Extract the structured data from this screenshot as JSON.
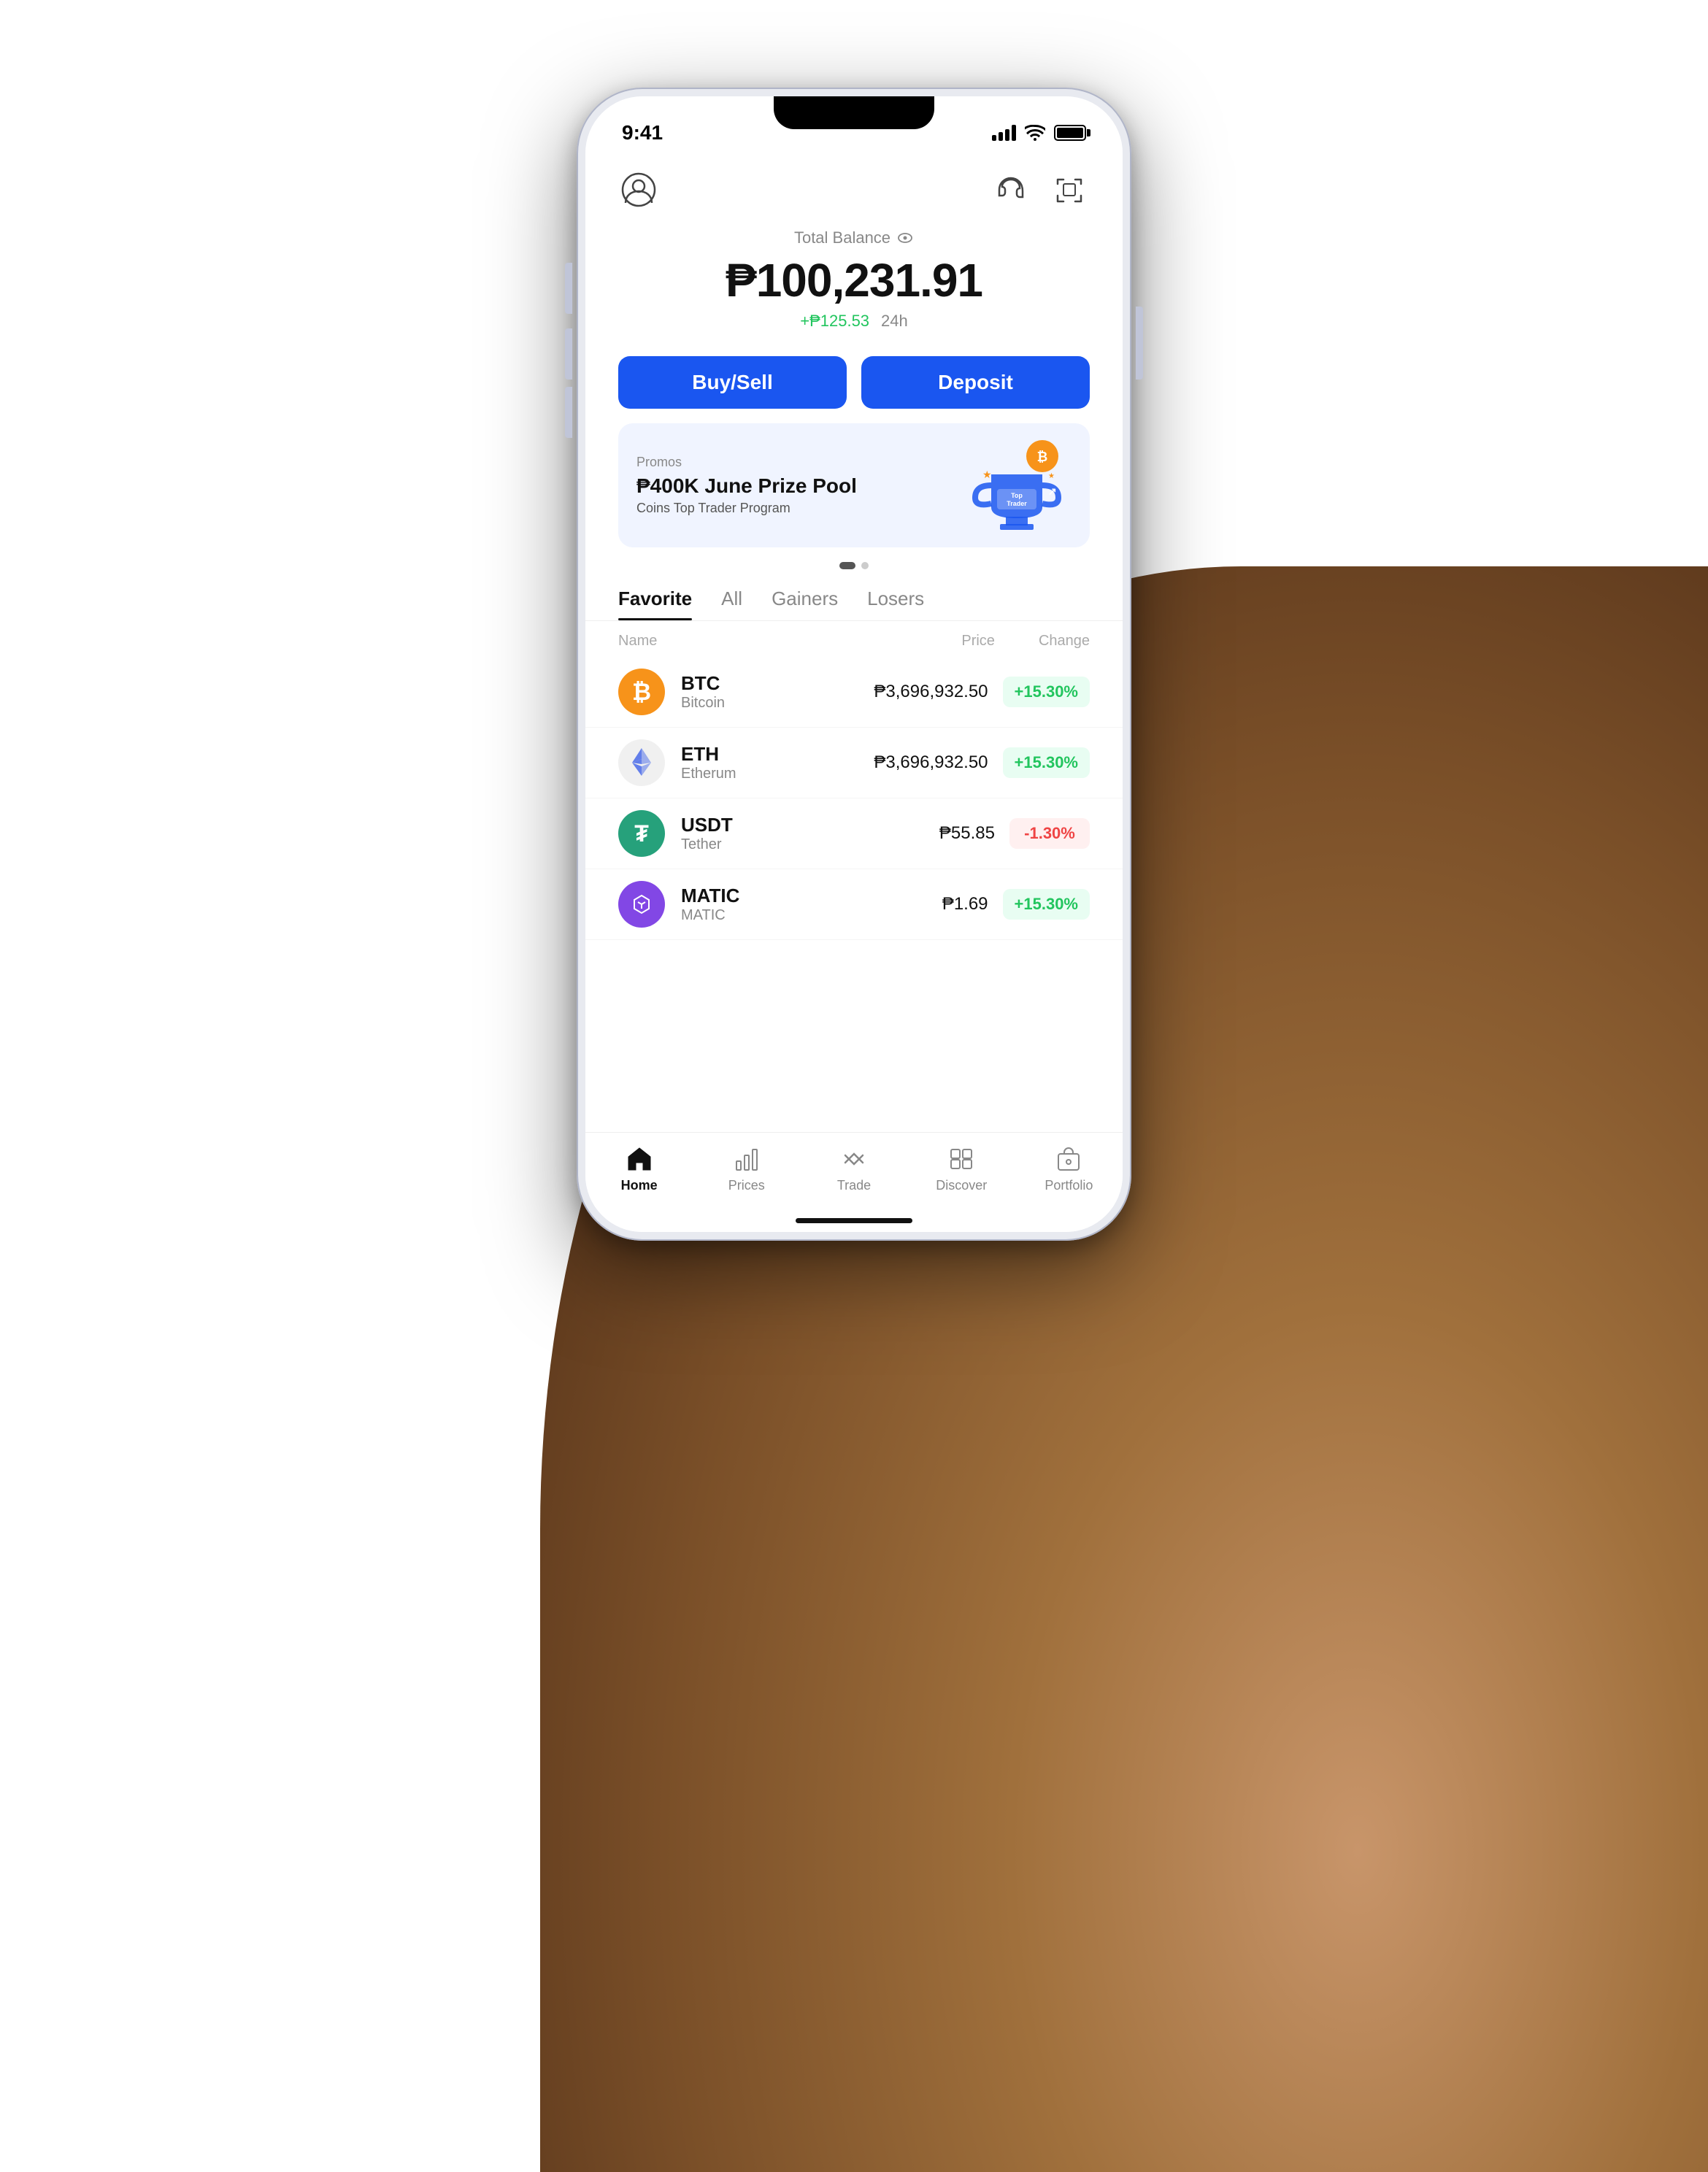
{
  "status_bar": {
    "time": "9:41"
  },
  "header": {
    "balance_label": "Total Balance",
    "balance_amount": "₱100,231.91",
    "balance_change": "+₱125.53",
    "balance_period": "24h"
  },
  "actions": {
    "buy_sell": "Buy/Sell",
    "deposit": "Deposit"
  },
  "promo": {
    "label": "Promos",
    "title": "₱400K June Prize Pool",
    "subtitle": "Coins Top Trader Program",
    "banner_text": "Top Trader"
  },
  "tabs": [
    {
      "id": "favorite",
      "label": "Favorite",
      "active": true
    },
    {
      "id": "all",
      "label": "All",
      "active": false
    },
    {
      "id": "gainers",
      "label": "Gainers",
      "active": false
    },
    {
      "id": "losers",
      "label": "Losers",
      "active": false
    }
  ],
  "list_headers": {
    "name": "Name",
    "price": "Price",
    "change": "Change"
  },
  "coins": [
    {
      "symbol": "BTC",
      "name": "Bitcoin",
      "price": "₱3,696,932.50",
      "change": "+15.30%",
      "change_type": "positive",
      "icon_type": "btc"
    },
    {
      "symbol": "ETH",
      "name": "Etherum",
      "price": "₱3,696,932.50",
      "change": "+15.30%",
      "change_type": "positive",
      "icon_type": "eth"
    },
    {
      "symbol": "USDT",
      "name": "Tether",
      "price": "₱55.85",
      "change": "-1.30%",
      "change_type": "negative",
      "icon_type": "usdt"
    },
    {
      "symbol": "MATIC",
      "name": "MATIC",
      "price": "₱1.69",
      "change": "+15.30%",
      "change_type": "positive",
      "icon_type": "matic"
    }
  ],
  "bottom_nav": [
    {
      "id": "home",
      "label": "Home",
      "active": true
    },
    {
      "id": "prices",
      "label": "Prices",
      "active": false
    },
    {
      "id": "trade",
      "label": "Trade",
      "active": false
    },
    {
      "id": "discover",
      "label": "Discover",
      "active": false
    },
    {
      "id": "portfolio",
      "label": "Portfolio",
      "active": false
    }
  ]
}
